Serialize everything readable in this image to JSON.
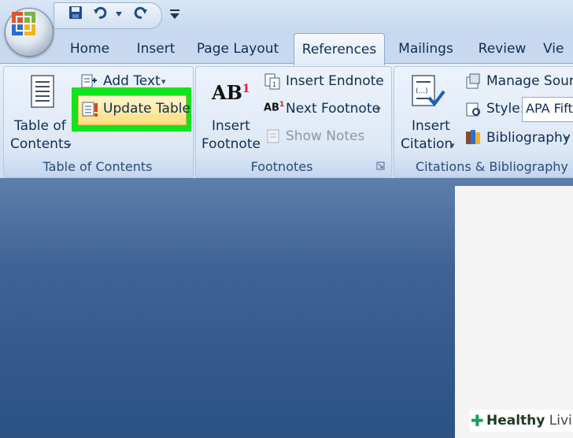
{
  "tabs": {
    "home": "Home",
    "insert": "Insert",
    "page_layout": "Page Layout",
    "references": "References",
    "mailings": "Mailings",
    "review": "Review",
    "view": "Vie"
  },
  "toc_group": {
    "toc_label_1": "Table of",
    "toc_label_2": "Contents",
    "add_text": "Add Text",
    "update_table": "Update Table",
    "group_name": "Table of Contents"
  },
  "footnotes_group": {
    "insert_footnote_1": "Insert",
    "insert_footnote_2": "Footnote",
    "ab_glyph": "AB",
    "ab_sup": "1",
    "insert_endnote": "Insert Endnote",
    "next_footnote": "Next Footnote",
    "show_notes": "Show Notes",
    "group_name": "Footnotes"
  },
  "citations_group": {
    "insert_citation_1": "Insert",
    "insert_citation_2": "Citation",
    "manage_sources": "Manage Sourc",
    "style_label": "Style:",
    "style_value": "APA Fifth",
    "bibliography": "Bibliography",
    "group_name": "Citations & Bibliography"
  },
  "watermark": {
    "text_bold": "Healthy",
    "text_light": "Living"
  },
  "colors": {
    "highlight": "#12e31e",
    "workspace": "#2f5483"
  }
}
